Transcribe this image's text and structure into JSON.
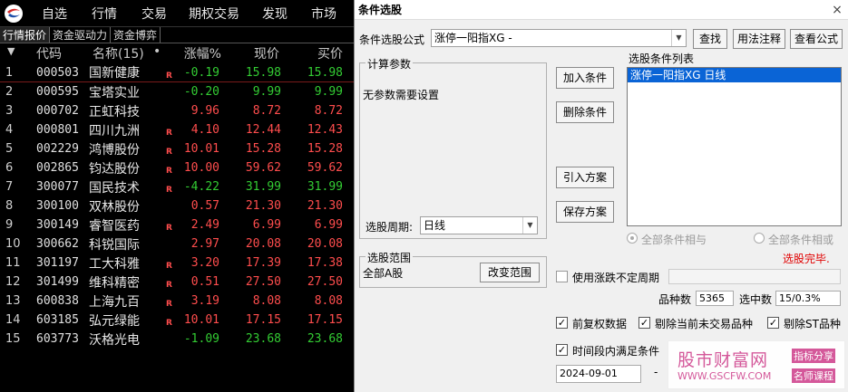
{
  "menu": [
    "自选",
    "行情",
    "交易",
    "期权交易",
    "发现",
    "市场"
  ],
  "tabs": [
    "行情报价",
    "资金驱动力",
    "资金博弈"
  ],
  "columns": {
    "code": "代码",
    "name": "名称(15)",
    "dot": "•",
    "change": "涨幅%",
    "price": "现价",
    "bid": "买价"
  },
  "rows": [
    {
      "idx": "1",
      "code": "000503",
      "name": "国新健康",
      "r": "R",
      "change": "-0.19",
      "dir": "down",
      "price": "15.98",
      "bid": "15.98"
    },
    {
      "idx": "2",
      "code": "000595",
      "name": "宝塔实业",
      "r": "",
      "change": "-0.20",
      "dir": "down",
      "price": "9.99",
      "bid": "9.99"
    },
    {
      "idx": "3",
      "code": "000702",
      "name": "正虹科技",
      "r": "",
      "change": "9.96",
      "dir": "up",
      "price": "8.72",
      "bid": "8.72"
    },
    {
      "idx": "4",
      "code": "000801",
      "name": "四川九洲",
      "r": "R",
      "change": "4.10",
      "dir": "up",
      "price": "12.44",
      "bid": "12.43"
    },
    {
      "idx": "5",
      "code": "002229",
      "name": "鸿博股份",
      "r": "R",
      "change": "10.01",
      "dir": "up",
      "price": "15.28",
      "bid": "15.28"
    },
    {
      "idx": "6",
      "code": "002865",
      "name": "钧达股份",
      "r": "R",
      "change": "10.00",
      "dir": "up",
      "price": "59.62",
      "bid": "59.62"
    },
    {
      "idx": "7",
      "code": "300077",
      "name": "国民技术",
      "r": "R",
      "change": "-4.22",
      "dir": "down",
      "price": "31.99",
      "bid": "31.99"
    },
    {
      "idx": "8",
      "code": "300100",
      "name": "双林股份",
      "r": "",
      "change": "0.57",
      "dir": "up",
      "price": "21.30",
      "bid": "21.30"
    },
    {
      "idx": "9",
      "code": "300149",
      "name": "睿智医药",
      "r": "R",
      "change": "2.49",
      "dir": "up",
      "price": "6.99",
      "bid": "6.99"
    },
    {
      "idx": "10",
      "code": "300662",
      "name": "科锐国际",
      "r": "",
      "change": "2.97",
      "dir": "up",
      "price": "20.08",
      "bid": "20.08"
    },
    {
      "idx": "11",
      "code": "301197",
      "name": "工大科雅",
      "r": "R",
      "change": "3.20",
      "dir": "up",
      "price": "17.39",
      "bid": "17.38"
    },
    {
      "idx": "12",
      "code": "301499",
      "name": "维科精密",
      "r": "R",
      "change": "0.51",
      "dir": "up",
      "price": "27.50",
      "bid": "27.50"
    },
    {
      "idx": "13",
      "code": "600838",
      "name": "上海九百",
      "r": "R",
      "change": "3.19",
      "dir": "up",
      "price": "8.08",
      "bid": "8.08"
    },
    {
      "idx": "14",
      "code": "603185",
      "name": "弘元绿能",
      "r": "R",
      "change": "10.01",
      "dir": "up",
      "price": "17.15",
      "bid": "17.15"
    },
    {
      "idx": "15",
      "code": "603773",
      "name": "沃格光电",
      "r": "",
      "change": "-1.09",
      "dir": "down",
      "price": "23.68",
      "bid": "23.68"
    }
  ],
  "colors": {
    "up": "#ff4d4d",
    "down": "#33cc33",
    "selection": "#0a64d6",
    "status_red": "#e00000"
  },
  "dialog": {
    "title": "条件选股",
    "close": "×",
    "formula_label": "条件选股公式",
    "formula_value": "涨停一阳指XG  -",
    "btn_find": "查找",
    "btn_usage": "用法注释",
    "btn_view": "查看公式",
    "calc_group": "计算参数",
    "calc_text": "无参数需要设置",
    "btn_add": "加入条件",
    "btn_delete": "删除条件",
    "btn_import": "引入方案",
    "btn_save": "保存方案",
    "list_title": "选股条件列表",
    "list_item": "涨停一阳指XG  日线",
    "period_label": "选股周期:",
    "period_value": "日线",
    "radio_all_and": "全部条件相与",
    "radio_all_or": "全部条件相或",
    "status": "选股完毕.",
    "range_group": "选股范围",
    "range_value": "全部A股",
    "btn_change_range": "改变范围",
    "chk_variable_period": "使用涨跌不定周期",
    "stock_count_label": "品种数",
    "stock_count": "5365",
    "selected_label": "选中数",
    "selected_value": "15/0.3%",
    "chk_prev_rights": "前复权数据",
    "chk_exclude_untraded": "剔除当前未交易品种",
    "chk_exclude_st": "剔除ST品种",
    "chk_time_range": "时间段内满足条件",
    "date_start": "2024-09-01",
    "date_sep": "-",
    "check_mark": "✓"
  },
  "watermark": {
    "main": "股市财富网",
    "url": "WWW.GSCFW.COM",
    "tag1": "指标分享",
    "tag2": "名师课程"
  }
}
